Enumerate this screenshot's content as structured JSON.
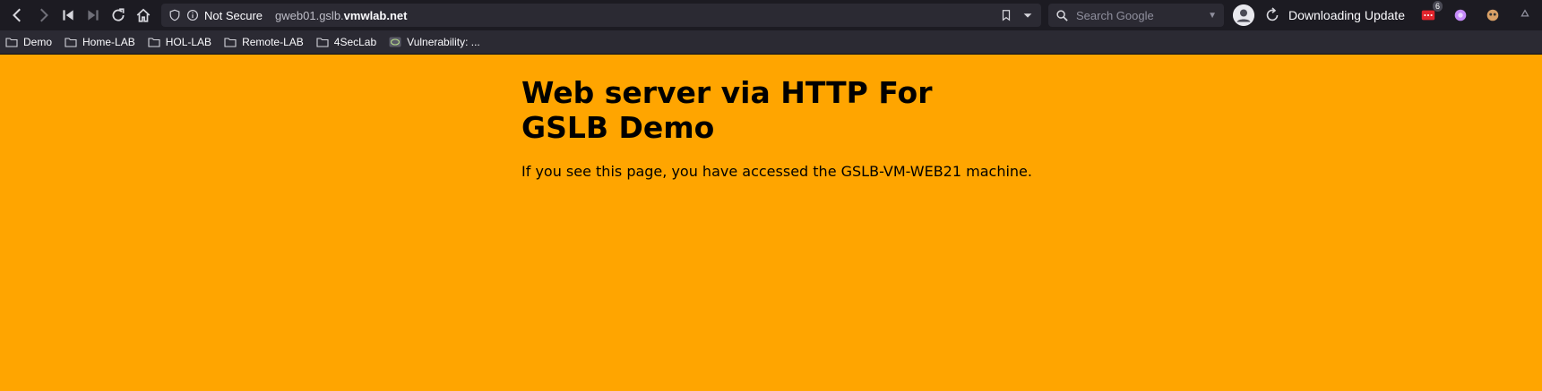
{
  "browser": {
    "security_label": "Not Secure",
    "url_prefix": "gweb01.gslb.",
    "url_domain": "vmwlab.net",
    "search_placeholder": "Search Google",
    "update_status": "Downloading Update",
    "extension_badge": "6"
  },
  "bookmarks": [
    {
      "label": "Demo"
    },
    {
      "label": "Home-LAB"
    },
    {
      "label": "HOL-LAB"
    },
    {
      "label": "Remote-LAB"
    },
    {
      "label": "4SecLab"
    },
    {
      "label": "Vulnerability: ..."
    }
  ],
  "page": {
    "heading": "Web server via HTTP For GSLB Demo",
    "text": "If you see this page, you have accessed the GSLB-VM-WEB21 machine."
  },
  "colors": {
    "page_background": "#ffa500",
    "toolbar_background": "#1c1b22",
    "bookmarks_background": "#2b2a33"
  }
}
